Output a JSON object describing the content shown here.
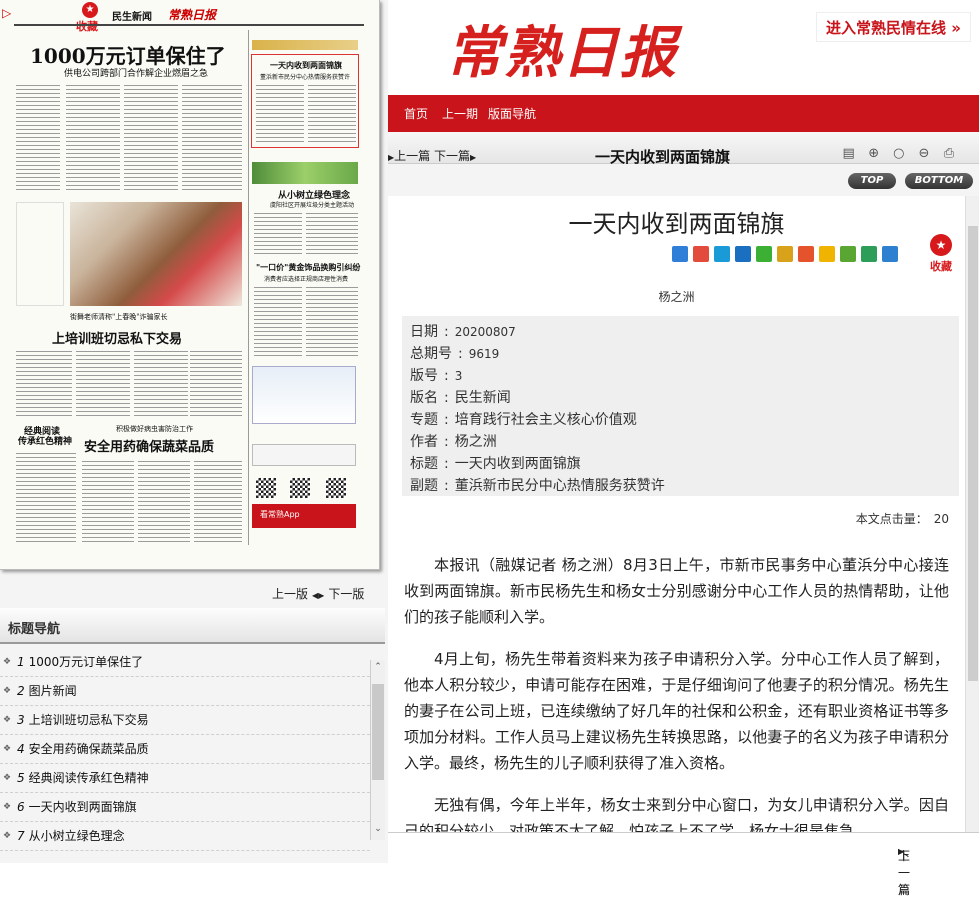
{
  "thumbnail": {
    "collect_label": "收藏",
    "header_section": "民生新闻",
    "header_paper": "常熟日报",
    "headline_main": "1000万元订单保住了",
    "headline_sub": "供电公司跨部门合作解企业燃眉之急",
    "inset_title": "一天内收到两面锦旗",
    "inset_sub": "董浜新市民分中心热情服务获赞许",
    "green_title": "从小树立绿色理念",
    "green_sub": "虞阳社区开展垃圾分类主题活动",
    "gold_title": "\"一口价\"黄金饰品换购引纠纷",
    "gold_sub": "消费者应选择正规商店理性消费",
    "caption_top": "街舞老师清称\"上春晚\"诈骗家长",
    "headline_train": "上培训班切忌私下交易",
    "classic_title": "经典阅读",
    "classic_sub": "传承红色精神",
    "pest_sub": "积极做好病虫害防治工作",
    "headline_safe": "安全用药确保蔬菜品质",
    "app_label": "看常熟App"
  },
  "page_nav": {
    "prev": "上一版",
    "next": "下一版"
  },
  "topic_nav": {
    "title": "标题导航",
    "items": [
      {
        "num": "1",
        "label": "1000万元订单保住了"
      },
      {
        "num": "2",
        "label": "图片新闻"
      },
      {
        "num": "3",
        "label": "上培训班切忌私下交易"
      },
      {
        "num": "4",
        "label": "安全用药确保蔬菜品质"
      },
      {
        "num": "5",
        "label": "经典阅读传承红色精神"
      },
      {
        "num": "6",
        "label": "一天内收到两面锦旗"
      },
      {
        "num": "7",
        "label": "从小树立绿色理念"
      }
    ]
  },
  "header": {
    "masthead": "常熟日报",
    "enter_link": "进入常熟民情在线 »"
  },
  "nav": {
    "home": "首页",
    "prev_issue": "上一期",
    "page_nav": "版面导航"
  },
  "titlebar": {
    "prev": "上一篇",
    "next": "下一篇",
    "title": "一天内收到两面锦旗",
    "icons": [
      "document-icon",
      "zoom-in-icon",
      "zoom-reset-icon",
      "zoom-out-icon",
      "print-icon"
    ]
  },
  "scroll_buttons": {
    "top": "TOP",
    "bottom": "BOTTOM"
  },
  "article": {
    "title": "一天内收到两面锦旗",
    "author": "杨之洲",
    "favorite": "收藏",
    "meta": [
      {
        "key": "日期",
        "value": "20200807"
      },
      {
        "key": "总期号",
        "value": "9619"
      },
      {
        "key": "版号",
        "value": "3"
      },
      {
        "key": "版名",
        "value": "民生新闻"
      },
      {
        "key": "专题",
        "value": "培育践行社会主义核心价值观"
      },
      {
        "key": "作者",
        "value": "杨之洲"
      },
      {
        "key": "标题",
        "value": "一天内收到两面锦旗"
      },
      {
        "key": "副题",
        "value": "董浜新市民分中心热情服务获赞许"
      }
    ],
    "hits_label": "本文点击量：",
    "hits_value": "20",
    "paragraphs": [
      "本报讯（融媒记者 杨之洲）8月3日上午，市新市民事务中心董浜分中心接连收到两面锦旗。新市民杨先生和杨女士分别感谢分中心工作人员的热情帮助，让他们的孩子能顺利入学。",
      "4月上旬，杨先生带着资料来为孩子申请积分入学。分中心工作人员了解到，他本人积分较少，申请可能存在困难，于是仔细询问了他妻子的积分情况。杨先生的妻子在公司上班，已连续缴纳了好几年的社保和公积金，还有职业资格证书等多项加分材料。工作人员马上建议杨先生转换思路，以他妻子的名义为孩子申请积分入学。最终，杨先生的儿子顺利获得了准入资格。",
      "无独有偶，今年上半年，杨女士来到分中心窗口，为女儿申请积分入学。因自己的积分较少，对政策不太了解，怕孩子上不了学，杨女士很是焦急。"
    ],
    "share_colors": [
      "#2f7fd8",
      "#e34b3c",
      "#1a9ad6",
      "#1b6fc0",
      "#3cb034",
      "#d9a21b",
      "#e5532c",
      "#f0b400",
      "#5aa632",
      "#2d9e5a",
      "#2d7fd0"
    ]
  },
  "bottom_nav": {
    "prev": "上一篇",
    "next": "下一篇"
  }
}
